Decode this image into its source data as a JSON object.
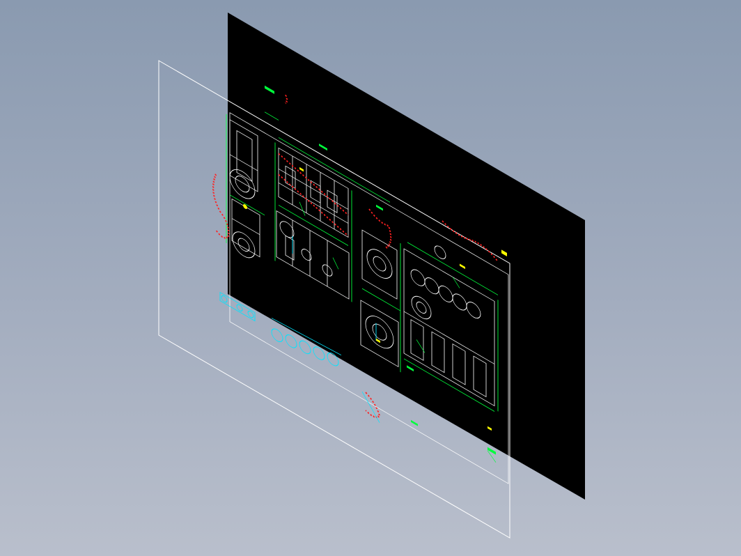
{
  "viewport": {
    "background_top": "#8a9ab0",
    "background_bottom": "#b9bfcc",
    "sheet_color": "#000000",
    "frame_color": "#ffffff"
  },
  "drawing_colors": {
    "outline": "#ffffff",
    "dimension": "#00ff3c",
    "hatch": "#ff2020",
    "centerline": "#00e5ff",
    "annotation": "#ffff00"
  }
}
